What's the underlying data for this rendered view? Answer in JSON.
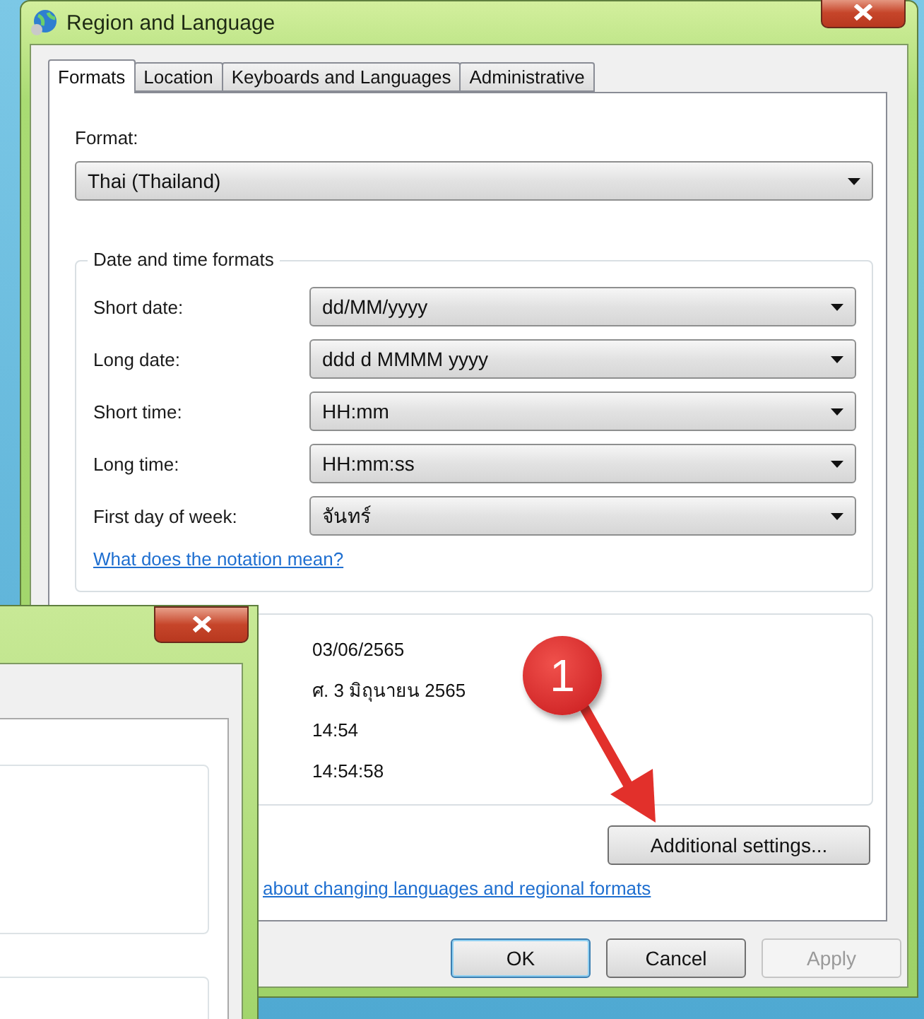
{
  "window": {
    "title": "Region and Language"
  },
  "tabs": [
    {
      "label": "Formats",
      "selected": true
    },
    {
      "label": "Location",
      "selected": false
    },
    {
      "label": "Keyboards and Languages",
      "selected": false
    },
    {
      "label": "Administrative",
      "selected": false
    }
  ],
  "format": {
    "label": "Format:",
    "value": "Thai (Thailand)"
  },
  "date_time_formats": {
    "title": "Date and time formats",
    "rows": [
      {
        "label": "Short date:",
        "value": "dd/MM/yyyy"
      },
      {
        "label": "Long date:",
        "value": "ddd d MMMM yyyy"
      },
      {
        "label": "Short time:",
        "value": "HH:mm"
      },
      {
        "label": "Long time:",
        "value": "HH:mm:ss"
      },
      {
        "label": "First day of week:",
        "value": "จันทร์"
      }
    ],
    "link": "What does the notation mean?"
  },
  "examples": {
    "values": [
      "03/06/2565",
      "ศ. 3 มิถุนายน 2565",
      "14:54",
      "14:54:58"
    ]
  },
  "additional_settings_button": "Additional settings...",
  "help_link": "about changing languages and regional formats",
  "buttons": [
    {
      "label": "OK",
      "default": true,
      "disabled": false
    },
    {
      "label": "Cancel",
      "default": false,
      "disabled": false
    },
    {
      "label": "Apply",
      "default": false,
      "disabled": true
    }
  ],
  "annotation": {
    "number": "1"
  }
}
